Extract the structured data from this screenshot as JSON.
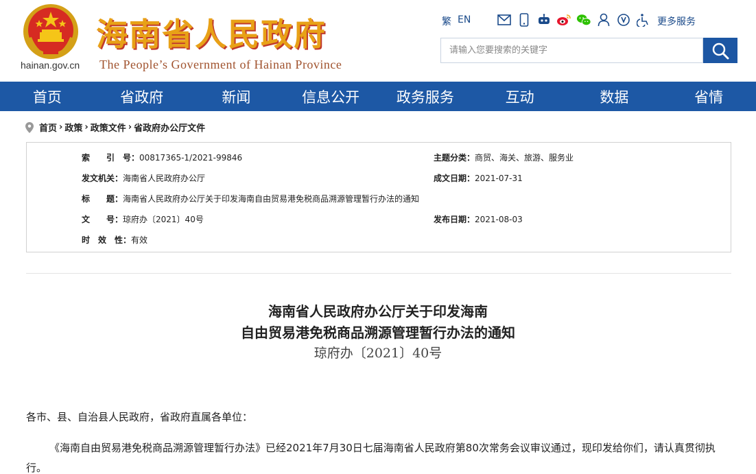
{
  "header": {
    "site_title": "海南省人民政府",
    "site_subtitle": "The People’s Government  of Hainan Province",
    "domain": "hainan.gov.cn",
    "lang_cn": "繁",
    "lang_en": "EN",
    "more_services": "更多服务",
    "search_placeholder": "请输入您要搜索的关键字",
    "brand_color": "#1d58a5"
  },
  "nav": {
    "items": [
      "首页",
      "省政府",
      "新闻",
      "信息公开",
      "政务服务",
      "互动",
      "数据",
      "省情"
    ]
  },
  "breadcrumb": {
    "items": [
      "首页",
      "政策",
      "政策文件",
      "省政府办公厅文件"
    ],
    "separator": "›"
  },
  "info": {
    "index_label": "索　　引　号：",
    "index_value": "00817365-1/2021-99846",
    "topic_label": "主题分类：",
    "topic_value": "商贸、海关、旅游、服务业",
    "issuer_label": "发文机关：",
    "issuer_value": "海南省人民政府办公厅",
    "date_created_label": "成文日期：",
    "date_created_value": "2021-07-31",
    "title_label": "标　　题：",
    "title_value": "海南省人民政府办公厅关于印发海南自由贸易港免税商品溯源管理暂行办法的通知",
    "docno_label": "文　　号：",
    "docno_value": "琼府办〔2021〕40号",
    "publish_label": "发布日期：",
    "publish_value": "2021-08-03",
    "validity_label": "时　效　性：",
    "validity_value": "有效"
  },
  "article": {
    "title_line1": "海南省人民政府办公厅关于印发海南",
    "title_line2": "自由贸易港免税商品溯源管理暂行办法的通知",
    "doc_number": "琼府办〔2021〕40号",
    "salutation": "各市、县、自治县人民政府，省政府直属各单位：",
    "paragraph1": "《海南自由贸易港免税商品溯源管理暂行办法》已经2021年7月30日七届海南省人民政府第80次常务会议审议通过，现印发给你们，请认真贯彻执行。"
  }
}
